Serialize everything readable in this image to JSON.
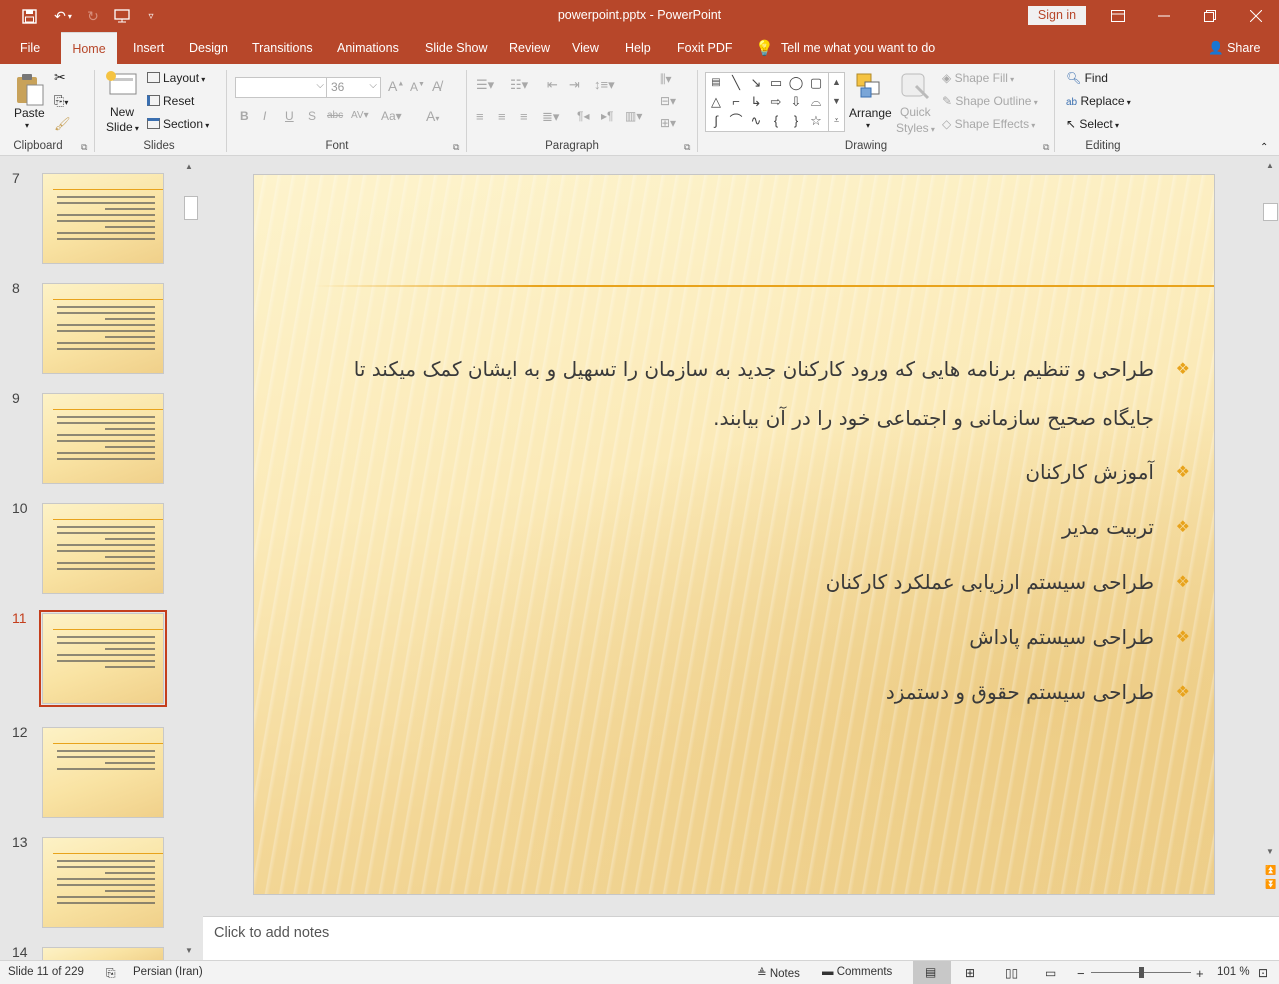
{
  "window": {
    "title": "powerpoint.pptx  -  PowerPoint",
    "sign_in": "Sign in"
  },
  "tabs": [
    "File",
    "Home",
    "Insert",
    "Design",
    "Transitions",
    "Animations",
    "Slide Show",
    "Review",
    "View",
    "Help",
    "Foxit PDF"
  ],
  "active_tab": "Home",
  "tell_me": "Tell me what you want to do",
  "share": "Share",
  "ribbon": {
    "clipboard": {
      "label": "Clipboard",
      "paste": "Paste"
    },
    "slides": {
      "label": "Slides",
      "new_slide_1": "New",
      "new_slide_2": "Slide",
      "layout": "Layout",
      "reset": "Reset",
      "section": "Section"
    },
    "font": {
      "label": "Font",
      "font_size": "36"
    },
    "paragraph": {
      "label": "Paragraph"
    },
    "drawing": {
      "label": "Drawing",
      "arrange": "Arrange",
      "quick_1": "Quick",
      "quick_2": "Styles",
      "shape_fill": "Shape Fill",
      "shape_outline": "Shape Outline",
      "shape_effects": "Shape Effects"
    },
    "editing": {
      "label": "Editing",
      "find": "Find",
      "replace": "Replace",
      "select": "Select"
    }
  },
  "thumbnails": [
    {
      "num": "7"
    },
    {
      "num": "8"
    },
    {
      "num": "9"
    },
    {
      "num": "10"
    },
    {
      "num": "11",
      "selected": true
    },
    {
      "num": "12"
    },
    {
      "num": "13"
    },
    {
      "num": "14"
    }
  ],
  "slide": {
    "bullets": [
      {
        "line1": "طراحی و تنظیم برنامه هایی که ورود کارکنان جدید به سازمان را تسهیل و به ایشان کمک میکند تا",
        "line2": "جایگاه صحیح سازمانی و اجتماعی خود را در آن بیابند."
      },
      {
        "line1": "آموزش کارکنان"
      },
      {
        "line1": "تربیت مدیر"
      },
      {
        "line1": "طراحی سیستم ارزیابی عملکرد کارکنان"
      },
      {
        "line1": "طراحی سیستم پاداش"
      },
      {
        "line1": "طراحی سیستم حقوق و دستمزد"
      }
    ],
    "accent_color": "#e8a31c"
  },
  "notes_placeholder": "Click to add notes",
  "status": {
    "slide_info": "Slide 11 of 229",
    "language": "Persian (Iran)",
    "notes": "Notes",
    "comments": "Comments",
    "zoom": "101 %"
  }
}
